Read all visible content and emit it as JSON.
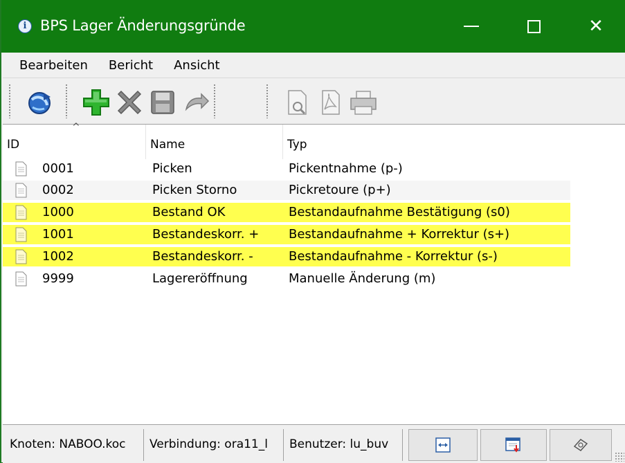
{
  "window": {
    "title": "BPS Lager Änderungsgründe",
    "controls": [
      "minimize",
      "maximize",
      "close"
    ]
  },
  "menu": [
    "Bearbeiten",
    "Bericht",
    "Ansicht"
  ],
  "toolbar": {
    "buttons": [
      {
        "name": "refresh",
        "icon": "refresh-globe-icon"
      },
      {
        "name": "add",
        "icon": "plus-icon"
      },
      {
        "name": "delete",
        "icon": "x-icon"
      },
      {
        "name": "save",
        "icon": "floppy-icon"
      },
      {
        "name": "undo",
        "icon": "undo-icon"
      },
      {
        "name": "preview",
        "icon": "print-preview-icon"
      },
      {
        "name": "pdf",
        "icon": "pdf-icon"
      },
      {
        "name": "print",
        "icon": "printer-icon"
      }
    ]
  },
  "list": {
    "columns": [
      "ID",
      "Name",
      "Typ"
    ],
    "sort_indicator": "^",
    "rows": [
      {
        "id": "0001",
        "name": "Picken",
        "typ": "Pickentnahme (p-)",
        "highlight": false
      },
      {
        "id": "0002",
        "name": "Picken Storno",
        "typ": "Pickretoure (p+)",
        "highlight": false
      },
      {
        "id": "1000",
        "name": "Bestand OK",
        "typ": "Bestandaufnahme Bestätigung (s0)",
        "highlight": true
      },
      {
        "id": "1001",
        "name": "Bestandeskorr. +",
        "typ": "Bestandaufnahme + Korrektur (s+)",
        "highlight": true
      },
      {
        "id": "1002",
        "name": "Bestandeskorr. -",
        "typ": "Bestandaufnahme - Korrektur (s-)",
        "highlight": true
      },
      {
        "id": "9999",
        "name": "Lagereröffnung",
        "typ": "Manuelle Änderung (m)",
        "highlight": false
      }
    ]
  },
  "statusbar": {
    "knoten": "Knoten: NABOO.koc",
    "verbindung": "Verbindung: ora11_l",
    "benutzer": "Benutzer: lu_buv"
  },
  "colors": {
    "titlebar": "#107c10",
    "highlight_row": "#ffff4f",
    "add_green": "#2fb52f"
  }
}
